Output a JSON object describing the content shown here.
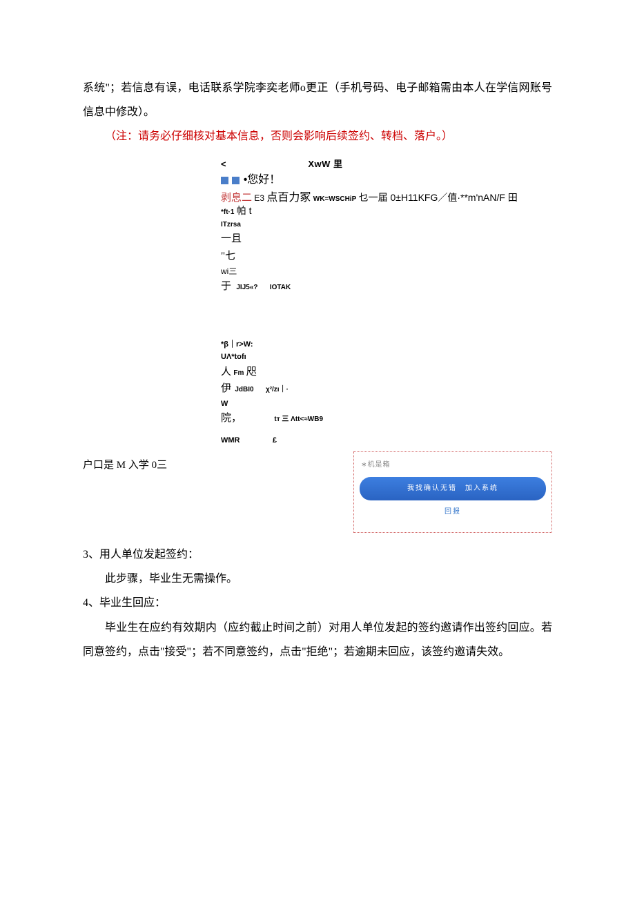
{
  "para1": "系统\"；若信息有误，电话联系学院李奕老师o更正（手机号码、电子邮箱需由本人在学信网账号信息中修改）。",
  "note": "（注：请务必仔细核对基本信息，否则会影响后续签约、转档、落户。）",
  "shot": {
    "topbar_left": "<",
    "topbar_right": "XwW 里",
    "greeting_suffix": "•您好！",
    "line_colored_a": "剥息二",
    "line_colored_b": "E3",
    "line2a": "点百力冢",
    "line2b": "WK=WSCHiP",
    "line2c": "乜一届 0±H11KFG／值·**m'nAN/F 田",
    "line3a": "*ft·1",
    "line3b": "帕 t",
    "line4": "ITzrsa",
    "line5": "一且",
    "line6": "\"七",
    "line7": "wi三",
    "line8a": "于",
    "line8b": "JIJ5«?",
    "line8c": "IOTAK",
    "sep": "",
    "block2_l1": "*β｜r>W:",
    "block2_l2": "UΛ*tofı",
    "block2_l3a": "人",
    "block2_l3b": "Fm",
    "block2_l3c": "咫",
    "block2_l4a": "伊",
    "block2_l4b": "JdBI0",
    "block2_l4c": "χ²/zı｜·",
    "block2_l5": "W",
    "block2_l6a": "院，",
    "block2_l6b": "tт 三 Λtt<≈WB9",
    "block2_l7a": "WMR",
    "block2_l7b": "£"
  },
  "leftcap": "户口是 M 入学 0三",
  "confirm": {
    "field_label": "∗机是箱",
    "field_value": "",
    "button": "我找确认无错 加入系统",
    "back": "回报"
  },
  "sec3_head": "3、用人单位发起签约：",
  "sec3_body": "此步骤，毕业生无需操作。",
  "sec4_head": "4、毕业生回应：",
  "sec4_body": "毕业生在应约有效期内（应约截止时间之前）对用人单位发起的签约邀请作出签约回应。若同意签约，点击\"接受\"；若不同意签约，点击\"拒绝\"；若逾期未回应，该签约邀请失效。"
}
